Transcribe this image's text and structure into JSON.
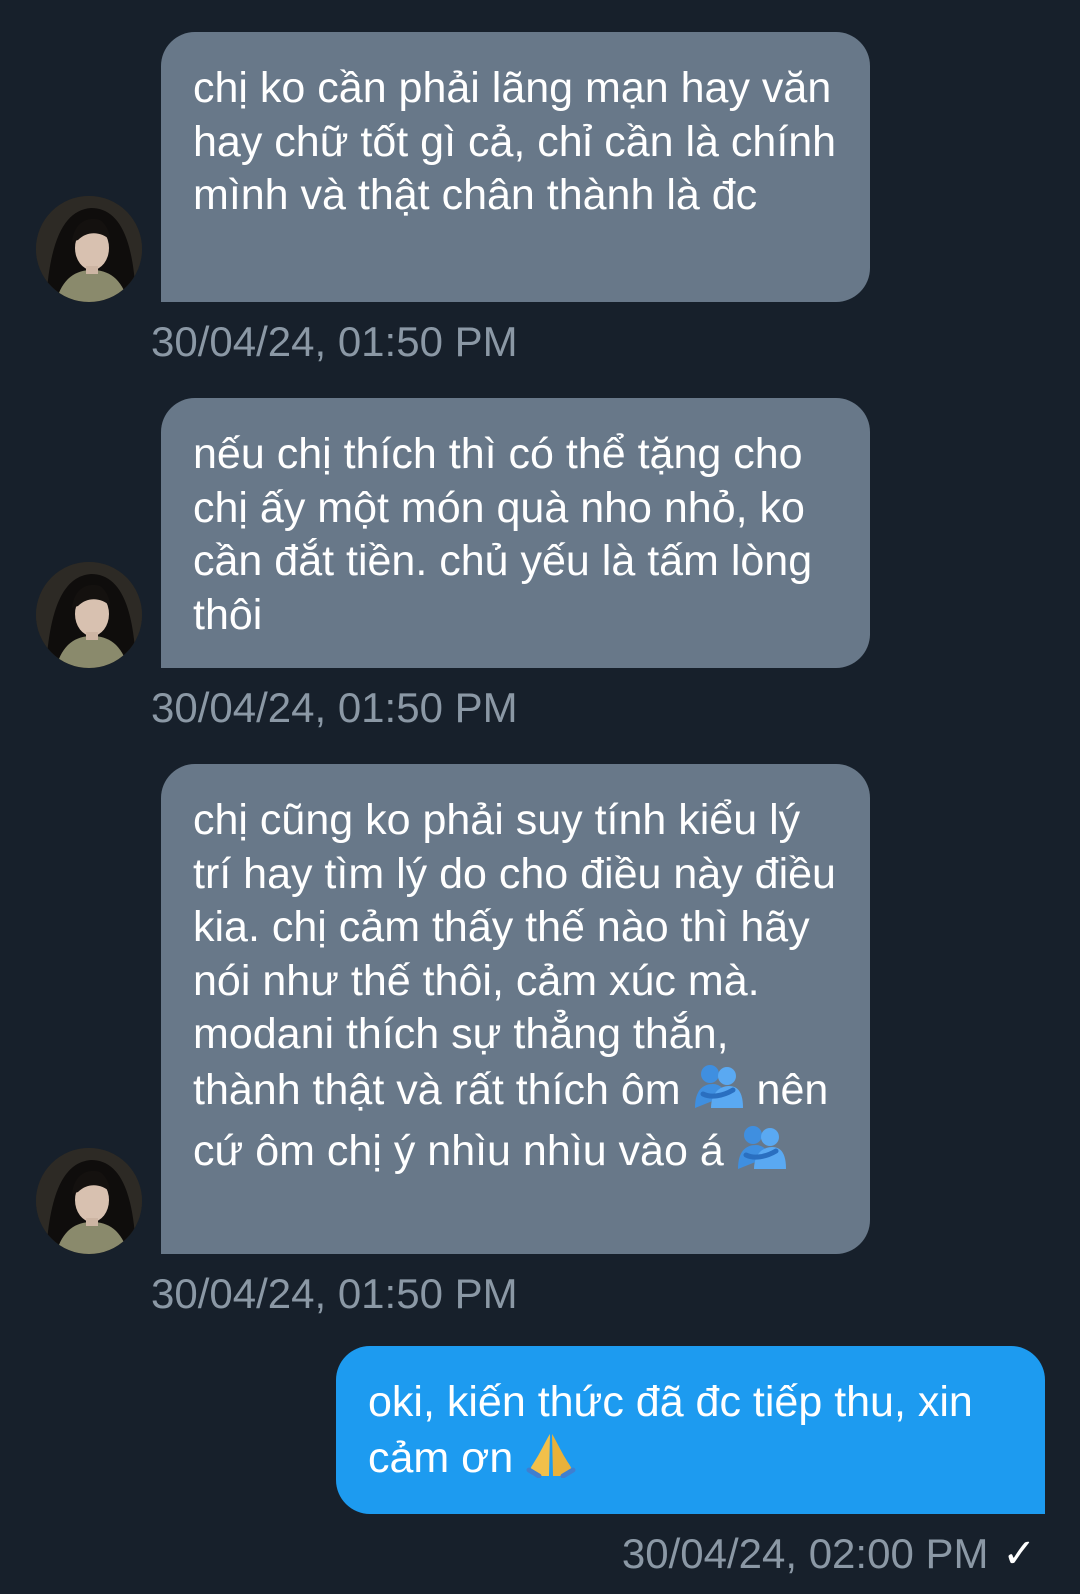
{
  "messages": [
    {
      "sender": "other",
      "text": "chị ko cần phải lãng mạn hay văn hay chữ tốt gì cả, chỉ cần là chính mình và thật chân thành là đc",
      "timestamp": "30/04/24, 01:50 PM"
    },
    {
      "sender": "other",
      "text": "nếu chị thích thì có thể tặng cho chị ấy một món quà nho nhỏ, ko cần đắt tiền. chủ yếu là tấm lòng thôi",
      "timestamp": "30/04/24, 01:50 PM"
    },
    {
      "sender": "other",
      "text_part1": "chị cũng ko phải suy tính kiểu lý trí hay tìm lý do cho điều này điều kia. chị cảm thấy thế nào thì hãy nói như thế thôi, cảm xúc mà. modani thích sự thẳng thắn, thành thật và rất thích ôm",
      "emoji_1": "people-hugging",
      "text_part2": "nên cứ ôm chị ý nhìu nhìu vào á",
      "emoji_2": "people-hugging",
      "timestamp": "30/04/24, 01:50 PM"
    },
    {
      "sender": "me",
      "text": "oki, kiến thức đã đc tiếp thu, xin cảm ơn",
      "emoji": "folded-hands",
      "timestamp": "30/04/24, 02:00 PM",
      "status": "✓"
    }
  ],
  "colors": {
    "background": "#17202b",
    "incoming_bubble": "#687889",
    "outgoing_bubble": "#1d9bf0",
    "timestamp": "#8b98a5"
  }
}
